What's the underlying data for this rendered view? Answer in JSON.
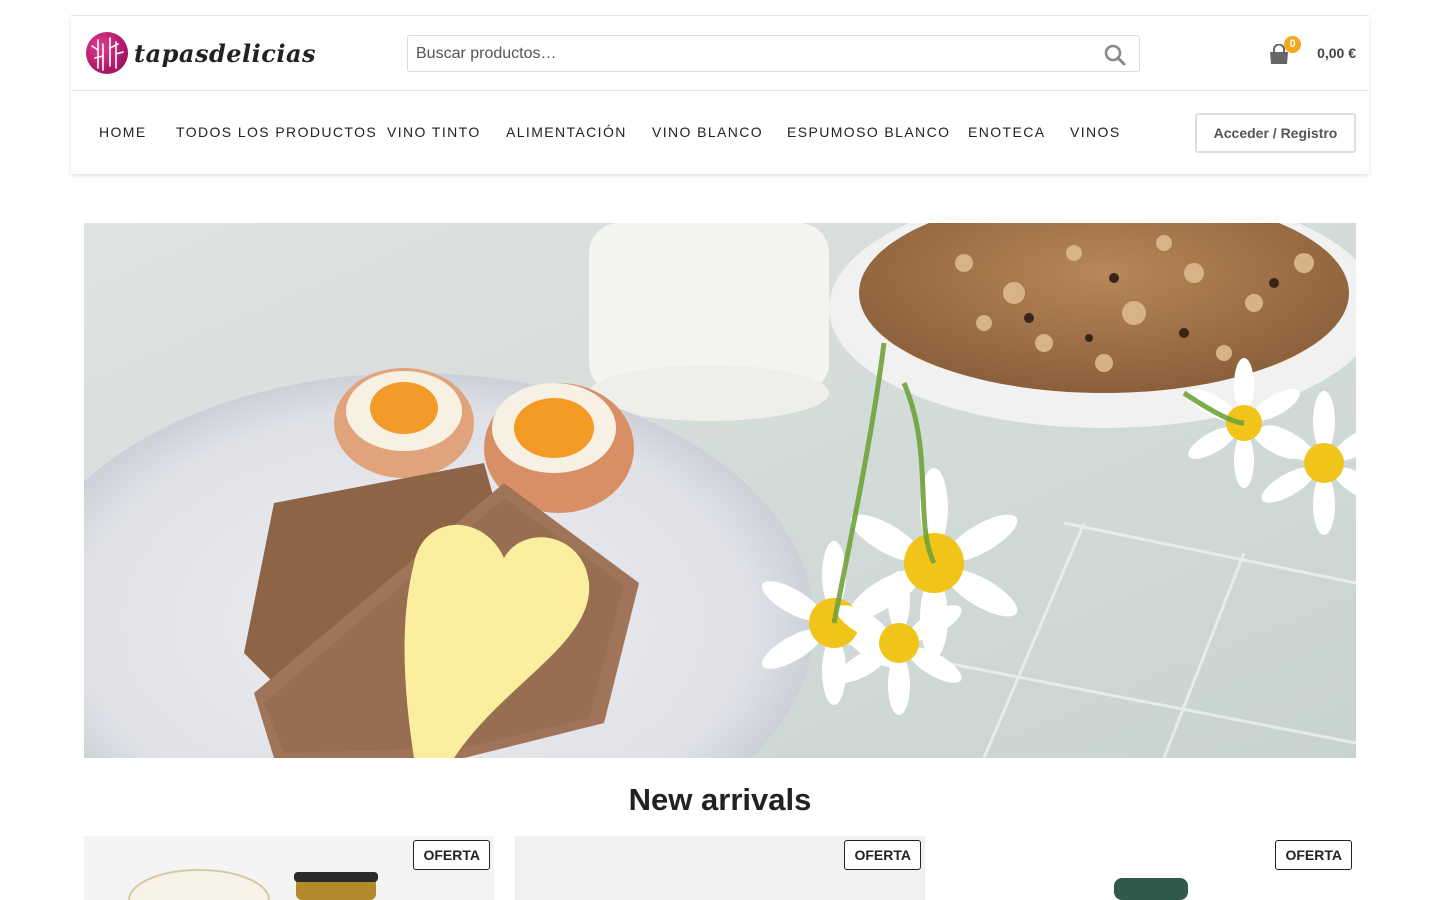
{
  "brand": {
    "name": "tapasdelicias"
  },
  "search": {
    "placeholder": "Buscar productos…"
  },
  "cart": {
    "count": "0",
    "total": "0,00 €"
  },
  "nav": {
    "items": [
      {
        "label": "HOME"
      },
      {
        "label": "TODOS LOS PRODUCTOS"
      },
      {
        "label": "VINO TINTO"
      },
      {
        "label": "ALIMENTACIÓN"
      },
      {
        "label": "VINO BLANCO"
      },
      {
        "label": "ESPUMOSO BLANCO"
      },
      {
        "label": "ENOTECA"
      },
      {
        "label": "VINOS"
      }
    ],
    "login_label": "Acceder / Registro"
  },
  "hero": {
    "image": "breakfast-photo"
  },
  "new_arrivals": {
    "title": "New arrivals",
    "products": [
      {
        "badge": "OFERTA"
      },
      {
        "badge": "OFERTA"
      },
      {
        "badge": "OFERTA"
      }
    ]
  },
  "colors": {
    "accent": "#f5a623",
    "logo": "#c2206f"
  }
}
